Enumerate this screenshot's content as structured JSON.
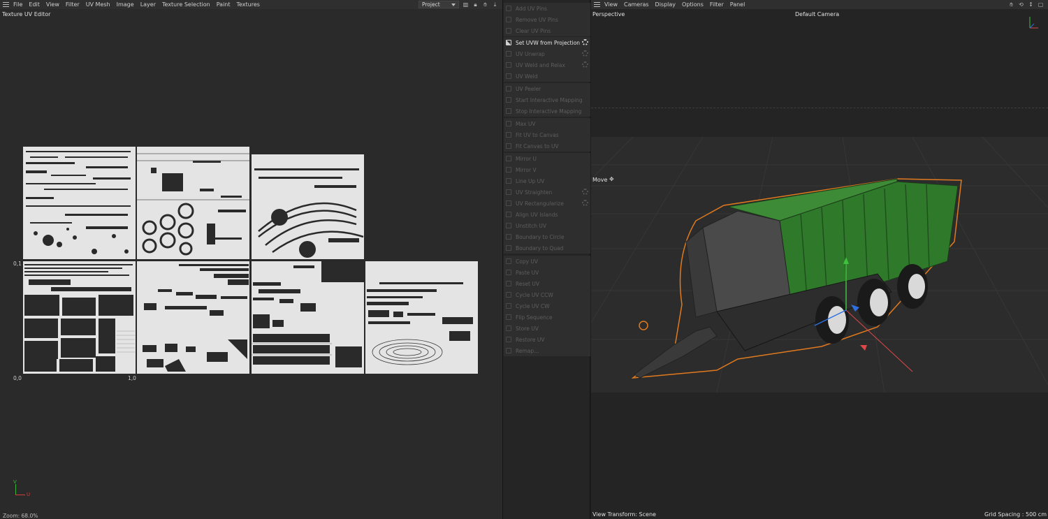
{
  "uv_editor": {
    "menu": [
      "File",
      "Edit",
      "View",
      "Filter",
      "UV Mesh",
      "Image",
      "Layer",
      "Texture Selection",
      "Paint",
      "Textures"
    ],
    "project_dropdown": "Project",
    "title": "Texture UV Editor",
    "label_origin": "0,0",
    "label_u1": "1,0",
    "label_v1": "0,1",
    "axis_v": "V",
    "axis_u": "U",
    "status": "Zoom: 68.0%"
  },
  "uv_commands": {
    "groups": [
      [
        "Add UV Pins",
        "Remove UV Pins",
        "Clear UV Pins"
      ],
      [
        "Set UVW from Projection",
        "UV Unwrap",
        "UV Weld and Relax",
        "UV Weld"
      ],
      [
        "UV Peeler",
        "Start Interactive Mapping",
        "Stop Interactive Mapping"
      ],
      [
        "Max UV",
        "Fit UV to Canvas",
        "Fit Canvas to UV"
      ],
      [
        "Mirror U",
        "Mirror V",
        "Line Up UV",
        "UV Straighten",
        "UV Rectangularize",
        "Align UV Islands",
        "Unstitch UV",
        "Boundary to Circle",
        "Boundary to Quad"
      ],
      [
        "Copy UV",
        "Paste UV",
        "Reset UV",
        "Cycle UV CCW",
        "Cycle UV CW",
        "Flip Sequence",
        "Store UV",
        "Restore UV",
        "Remap..."
      ]
    ],
    "active_item": "Set UVW from Projection",
    "gear_items": [
      "Set UVW from Projection",
      "UV Unwrap",
      "UV Weld and Relax",
      "UV Straighten",
      "UV Rectangularize"
    ]
  },
  "viewport": {
    "menu": [
      "View",
      "Cameras",
      "Display",
      "Options",
      "Filter",
      "Panel"
    ],
    "view_name": "Perspective",
    "camera": "Default Camera",
    "tool": "Move",
    "view_transform": "View Transform: Scene",
    "grid_spacing": "Grid Spacing : 500 cm",
    "colors": {
      "trailer_green": "#2f7a2a",
      "selection_outline": "#e07a1f",
      "axis_x": "#e04848",
      "axis_y": "#3fc13f",
      "axis_z": "#2f6fe0"
    }
  }
}
